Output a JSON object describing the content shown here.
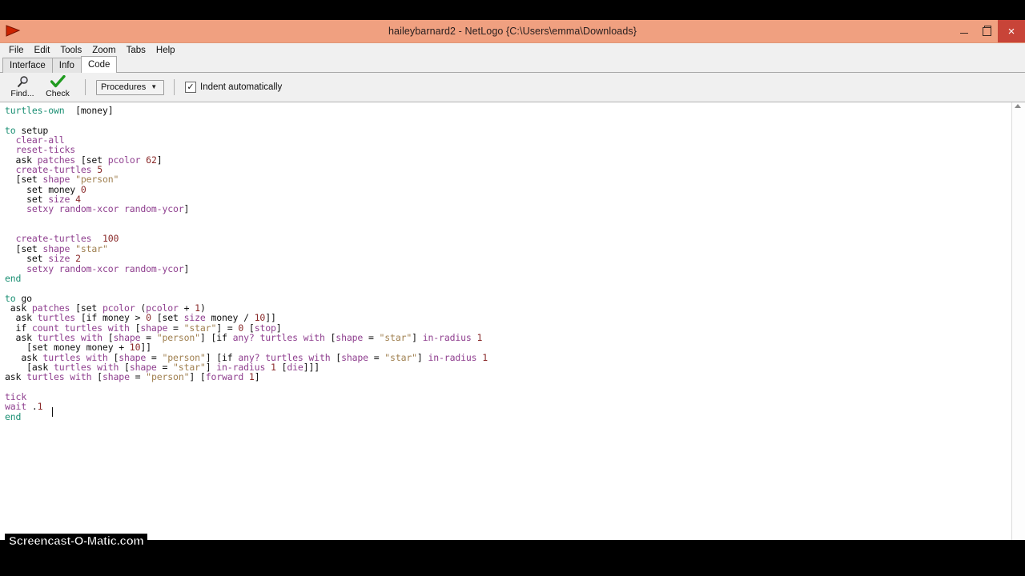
{
  "window": {
    "title": "haileybarnard2 - NetLogo {C:\\Users\\emma\\Downloads}",
    "logo_icon": "netlogo-arrow-icon",
    "controls": {
      "minimize": "minimize-icon",
      "maximize": "maximize-icon",
      "close_label": "×"
    }
  },
  "menubar": {
    "items": [
      {
        "label": "File"
      },
      {
        "label": "Edit"
      },
      {
        "label": "Tools"
      },
      {
        "label": "Zoom"
      },
      {
        "label": "Tabs"
      },
      {
        "label": "Help"
      }
    ]
  },
  "tabs": [
    {
      "label": "Interface",
      "active": false
    },
    {
      "label": "Info",
      "active": false
    },
    {
      "label": "Code",
      "active": true
    }
  ],
  "toolbar": {
    "find_label": "Find...",
    "find_icon": "magnifier-icon",
    "check_label": "Check",
    "check_icon": "green-checkmark-icon",
    "procedures_label": "Procedures",
    "procedures_caret": "▼",
    "indent_label": "Indent automatically",
    "indent_checked": true,
    "indent_check_glyph": "✓"
  },
  "editor": {
    "scroll_up_icon": "scroll-up-arrow-icon",
    "lines": [
      [
        {
          "t": "turtles-own",
          "c": "k"
        },
        {
          "t": "  [money]",
          "c": "d"
        }
      ],
      [],
      [
        {
          "t": "to",
          "c": "k"
        },
        {
          "t": " setup",
          "c": "d"
        }
      ],
      [
        {
          "t": "  ",
          "c": "d"
        },
        {
          "t": "clear-all",
          "c": "p"
        }
      ],
      [
        {
          "t": "  ",
          "c": "d"
        },
        {
          "t": "reset-ticks",
          "c": "p"
        }
      ],
      [
        {
          "t": "  ask ",
          "c": "d"
        },
        {
          "t": "patches",
          "c": "p"
        },
        {
          "t": " [set ",
          "c": "d"
        },
        {
          "t": "pcolor",
          "c": "p"
        },
        {
          "t": " ",
          "c": "d"
        },
        {
          "t": "62",
          "c": "n"
        },
        {
          "t": "]",
          "c": "d"
        }
      ],
      [
        {
          "t": "  ",
          "c": "d"
        },
        {
          "t": "create-turtles",
          "c": "p"
        },
        {
          "t": " ",
          "c": "d"
        },
        {
          "t": "5",
          "c": "n"
        }
      ],
      [
        {
          "t": "  [set ",
          "c": "d"
        },
        {
          "t": "shape",
          "c": "p"
        },
        {
          "t": " ",
          "c": "d"
        },
        {
          "t": "\"person\"",
          "c": "s"
        }
      ],
      [
        {
          "t": "    set money ",
          "c": "d"
        },
        {
          "t": "0",
          "c": "n"
        }
      ],
      [
        {
          "t": "    set ",
          "c": "d"
        },
        {
          "t": "size",
          "c": "p"
        },
        {
          "t": " ",
          "c": "d"
        },
        {
          "t": "4",
          "c": "n"
        }
      ],
      [
        {
          "t": "    ",
          "c": "d"
        },
        {
          "t": "setxy random-xcor random-ycor",
          "c": "p"
        },
        {
          "t": "]",
          "c": "d"
        }
      ],
      [],
      [],
      [
        {
          "t": "  ",
          "c": "d"
        },
        {
          "t": "create-turtles",
          "c": "p"
        },
        {
          "t": "  ",
          "c": "d"
        },
        {
          "t": "100",
          "c": "n"
        }
      ],
      [
        {
          "t": "  [set ",
          "c": "d"
        },
        {
          "t": "shape",
          "c": "p"
        },
        {
          "t": " ",
          "c": "d"
        },
        {
          "t": "\"star\"",
          "c": "s"
        }
      ],
      [
        {
          "t": "    set ",
          "c": "d"
        },
        {
          "t": "size",
          "c": "p"
        },
        {
          "t": " ",
          "c": "d"
        },
        {
          "t": "2",
          "c": "n"
        }
      ],
      [
        {
          "t": "    ",
          "c": "d"
        },
        {
          "t": "setxy random-xcor random-ycor",
          "c": "p"
        },
        {
          "t": "]",
          "c": "d"
        }
      ],
      [
        {
          "t": "end",
          "c": "k"
        }
      ],
      [],
      [
        {
          "t": "to",
          "c": "k"
        },
        {
          "t": " go",
          "c": "d"
        }
      ],
      [
        {
          "t": " ask ",
          "c": "d"
        },
        {
          "t": "patches",
          "c": "p"
        },
        {
          "t": " [set ",
          "c": "d"
        },
        {
          "t": "pcolor",
          "c": "p"
        },
        {
          "t": " (",
          "c": "d"
        },
        {
          "t": "pcolor",
          "c": "p"
        },
        {
          "t": " + ",
          "c": "d"
        },
        {
          "t": "1",
          "c": "n"
        },
        {
          "t": ")",
          "c": "d"
        }
      ],
      [
        {
          "t": "  ask ",
          "c": "d"
        },
        {
          "t": "turtles",
          "c": "p"
        },
        {
          "t": " [if money > ",
          "c": "d"
        },
        {
          "t": "0",
          "c": "n"
        },
        {
          "t": " [set ",
          "c": "d"
        },
        {
          "t": "size",
          "c": "p"
        },
        {
          "t": " money / ",
          "c": "d"
        },
        {
          "t": "10",
          "c": "n"
        },
        {
          "t": "]]",
          "c": "d"
        }
      ],
      [
        {
          "t": "  if ",
          "c": "d"
        },
        {
          "t": "count turtles with",
          "c": "p"
        },
        {
          "t": " [",
          "c": "d"
        },
        {
          "t": "shape",
          "c": "p"
        },
        {
          "t": " = ",
          "c": "d"
        },
        {
          "t": "\"star\"",
          "c": "s"
        },
        {
          "t": "] = ",
          "c": "d"
        },
        {
          "t": "0",
          "c": "n"
        },
        {
          "t": " [",
          "c": "d"
        },
        {
          "t": "stop",
          "c": "p"
        },
        {
          "t": "]",
          "c": "d"
        }
      ],
      [
        {
          "t": "  ask ",
          "c": "d"
        },
        {
          "t": "turtles with",
          "c": "p"
        },
        {
          "t": " [",
          "c": "d"
        },
        {
          "t": "shape",
          "c": "p"
        },
        {
          "t": " = ",
          "c": "d"
        },
        {
          "t": "\"person\"",
          "c": "s"
        },
        {
          "t": "] [if ",
          "c": "d"
        },
        {
          "t": "any? turtles with",
          "c": "p"
        },
        {
          "t": " [",
          "c": "d"
        },
        {
          "t": "shape",
          "c": "p"
        },
        {
          "t": " = ",
          "c": "d"
        },
        {
          "t": "\"star\"",
          "c": "s"
        },
        {
          "t": "] ",
          "c": "d"
        },
        {
          "t": "in-radius",
          "c": "p"
        },
        {
          "t": " ",
          "c": "d"
        },
        {
          "t": "1",
          "c": "n"
        }
      ],
      [
        {
          "t": "    [set money money + ",
          "c": "d"
        },
        {
          "t": "10",
          "c": "n"
        },
        {
          "t": "]]",
          "c": "d"
        }
      ],
      [
        {
          "t": "   ask ",
          "c": "d"
        },
        {
          "t": "turtles with",
          "c": "p"
        },
        {
          "t": " [",
          "c": "d"
        },
        {
          "t": "shape",
          "c": "p"
        },
        {
          "t": " = ",
          "c": "d"
        },
        {
          "t": "\"person\"",
          "c": "s"
        },
        {
          "t": "] [if ",
          "c": "d"
        },
        {
          "t": "any? turtles with",
          "c": "p"
        },
        {
          "t": " [",
          "c": "d"
        },
        {
          "t": "shape",
          "c": "p"
        },
        {
          "t": " = ",
          "c": "d"
        },
        {
          "t": "\"star\"",
          "c": "s"
        },
        {
          "t": "] ",
          "c": "d"
        },
        {
          "t": "in-radius",
          "c": "p"
        },
        {
          "t": " ",
          "c": "d"
        },
        {
          "t": "1",
          "c": "n"
        }
      ],
      [
        {
          "t": "    [ask ",
          "c": "d"
        },
        {
          "t": "turtles with",
          "c": "p"
        },
        {
          "t": " [",
          "c": "d"
        },
        {
          "t": "shape",
          "c": "p"
        },
        {
          "t": " = ",
          "c": "d"
        },
        {
          "t": "\"star\"",
          "c": "s"
        },
        {
          "t": "] ",
          "c": "d"
        },
        {
          "t": "in-radius",
          "c": "p"
        },
        {
          "t": " ",
          "c": "d"
        },
        {
          "t": "1",
          "c": "n"
        },
        {
          "t": " [",
          "c": "d"
        },
        {
          "t": "die",
          "c": "p"
        },
        {
          "t": "]]]",
          "c": "d"
        }
      ],
      [
        {
          "t": "ask ",
          "c": "d"
        },
        {
          "t": "turtles with",
          "c": "p"
        },
        {
          "t": " [",
          "c": "d"
        },
        {
          "t": "shape",
          "c": "p"
        },
        {
          "t": " = ",
          "c": "d"
        },
        {
          "t": "\"person\"",
          "c": "s"
        },
        {
          "t": "] [",
          "c": "d"
        },
        {
          "t": "forward",
          "c": "p"
        },
        {
          "t": " ",
          "c": "d"
        },
        {
          "t": "1",
          "c": "n"
        },
        {
          "t": "]",
          "c": "d"
        }
      ],
      [],
      [
        {
          "t": "tick",
          "c": "p"
        }
      ],
      [
        {
          "t": "wait",
          "c": "p"
        },
        {
          "t": " .",
          "c": "d"
        },
        {
          "t": "1",
          "c": "n"
        }
      ],
      [
        {
          "t": "end",
          "c": "k"
        }
      ]
    ]
  },
  "watermark": {
    "text": "Screencast-O-Matic.com"
  }
}
